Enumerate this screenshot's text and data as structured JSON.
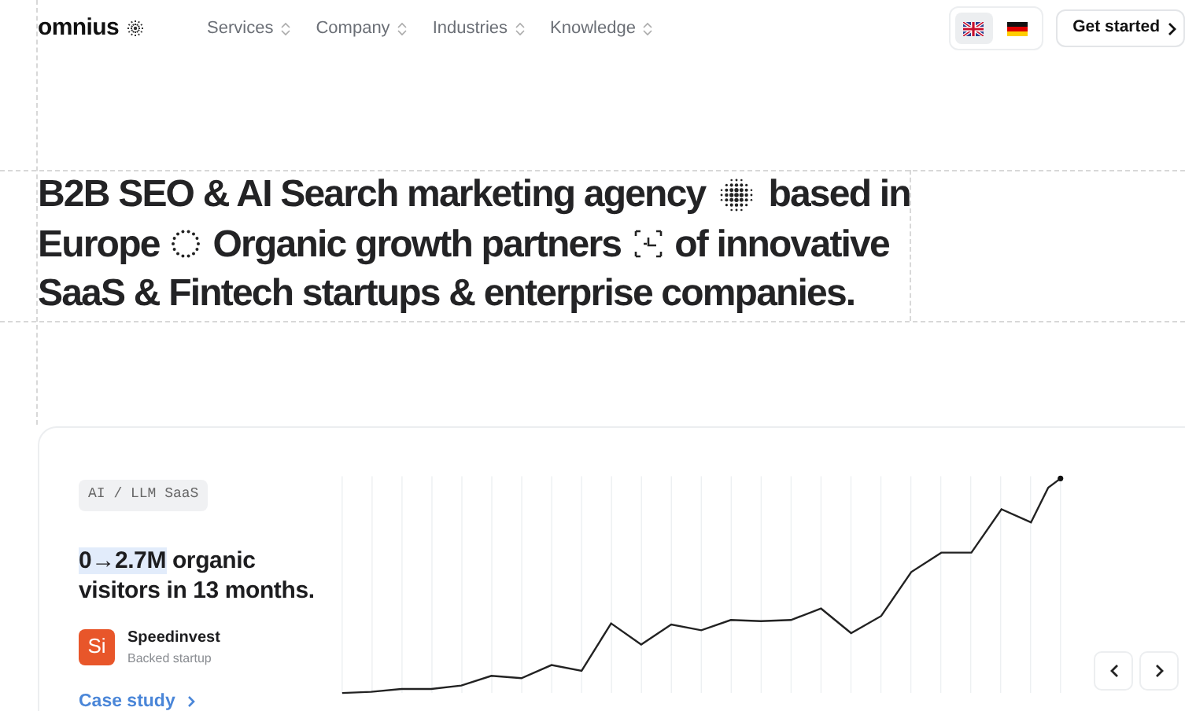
{
  "header": {
    "logo": "omnius",
    "nav": [
      {
        "label": "Services"
      },
      {
        "label": "Company"
      },
      {
        "label": "Industries"
      },
      {
        "label": "Knowledge"
      }
    ],
    "languages": [
      {
        "kind": "uk",
        "selected": true
      },
      {
        "kind": "de",
        "selected": false
      }
    ],
    "cta": "Get started"
  },
  "headline": [
    [
      {
        "kind": "text",
        "text": "B2B SEO & AI Search marketing agency"
      },
      {
        "kind": "dot-sphere"
      },
      {
        "kind": "text",
        "text": "based in"
      }
    ],
    [
      {
        "kind": "text",
        "text": "Europe"
      },
      {
        "kind": "dot-ring"
      },
      {
        "kind": "text",
        "text": "Organic growth partners"
      },
      {
        "kind": "dashed-corners"
      },
      {
        "kind": "text",
        "text": "of innovative"
      }
    ],
    [
      {
        "kind": "text",
        "text": "SaaS & Fintech startups & enterprise companies."
      }
    ]
  ],
  "case": {
    "tag": "AI / LLM SaaS",
    "highlight": "0→2.7M",
    "statement": "organic visitors in 13 months.",
    "company": {
      "initials": "Si",
      "name": "Speedinvest",
      "subtitle": "Backed startup",
      "color": "#e8562a"
    },
    "link": "Case study"
  }
}
